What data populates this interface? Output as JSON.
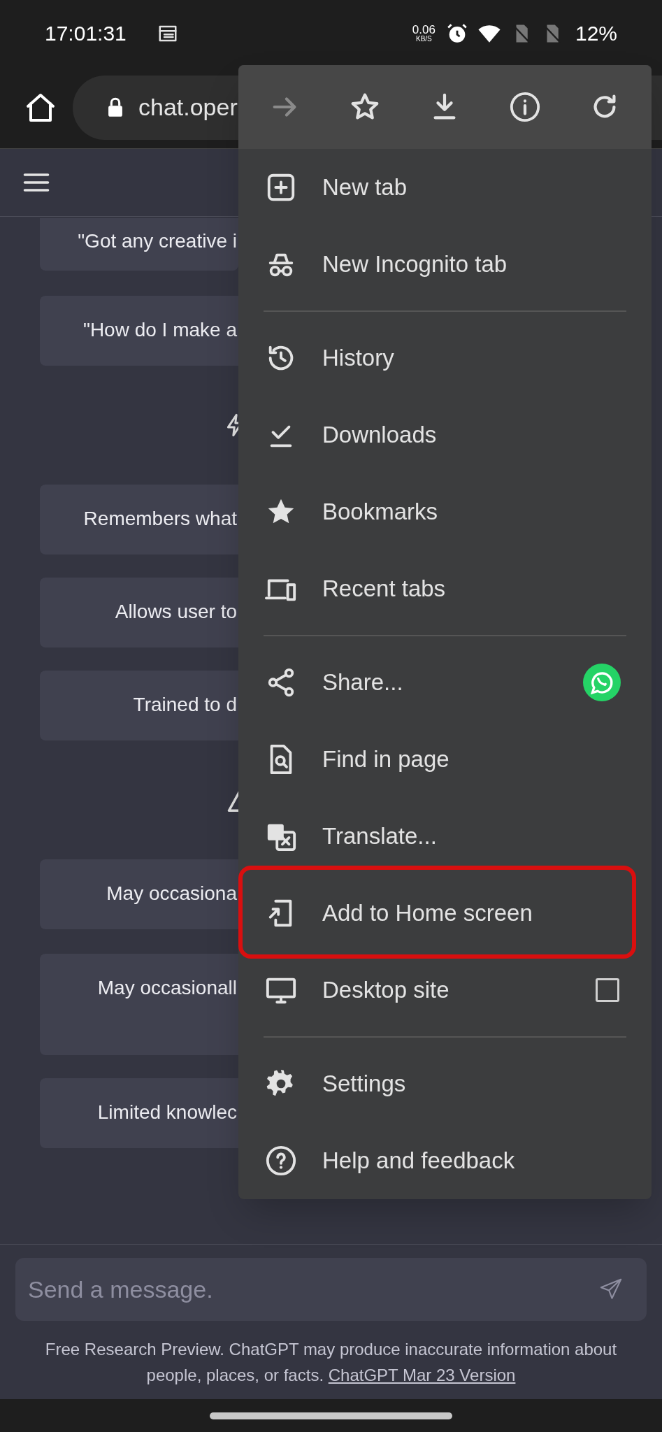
{
  "status_bar": {
    "time": "17:01:31",
    "net_speed": "0.06",
    "net_unit": "KB/S",
    "battery": "12%"
  },
  "address_bar": {
    "url": "chat.oper"
  },
  "sections": [
    {
      "cards": [
        "\"Got any creative i",
        "\"How do I make a"
      ]
    },
    {
      "cards": [
        "Remembers what",
        "Allows user to",
        "Trained to d"
      ]
    },
    {
      "cards": [
        "May occasiona",
        "May occasionall",
        "Limited knowlec"
      ]
    }
  ],
  "menu": {
    "toolbar": [
      {
        "disabled": true
      },
      {
        "disabled": false
      },
      {
        "disabled": false
      },
      {
        "disabled": false
      },
      {
        "disabled": false
      }
    ],
    "sections": [
      [
        {
          "label": "New tab",
          "kind": "plain",
          "highlighted": false
        },
        {
          "label": "New Incognito tab",
          "kind": "plain",
          "highlighted": false
        }
      ],
      [
        {
          "label": "History",
          "kind": "plain",
          "highlighted": false
        },
        {
          "label": "Downloads",
          "kind": "plain",
          "highlighted": false
        },
        {
          "label": "Bookmarks",
          "kind": "plain",
          "highlighted": false
        },
        {
          "label": "Recent tabs",
          "kind": "plain",
          "highlighted": false
        }
      ],
      [
        {
          "label": "Share...",
          "kind": "share",
          "highlighted": false
        },
        {
          "label": "Find in page",
          "kind": "plain",
          "highlighted": false
        },
        {
          "label": "Translate...",
          "kind": "plain",
          "highlighted": false
        },
        {
          "label": "Add to Home screen",
          "kind": "plain",
          "highlighted": true
        },
        {
          "label": "Desktop site",
          "kind": "checkbox",
          "checked": false,
          "highlighted": false
        }
      ],
      [
        {
          "label": "Settings",
          "kind": "plain",
          "highlighted": false
        },
        {
          "label": "Help and feedback",
          "kind": "plain",
          "highlighted": false
        }
      ]
    ]
  },
  "composer": {
    "placeholder": "Send a message."
  },
  "footer": {
    "text": "Free Research Preview. ChatGPT may produce inaccurate information about people, places, or facts.",
    "link": "ChatGPT Mar 23 Version"
  }
}
